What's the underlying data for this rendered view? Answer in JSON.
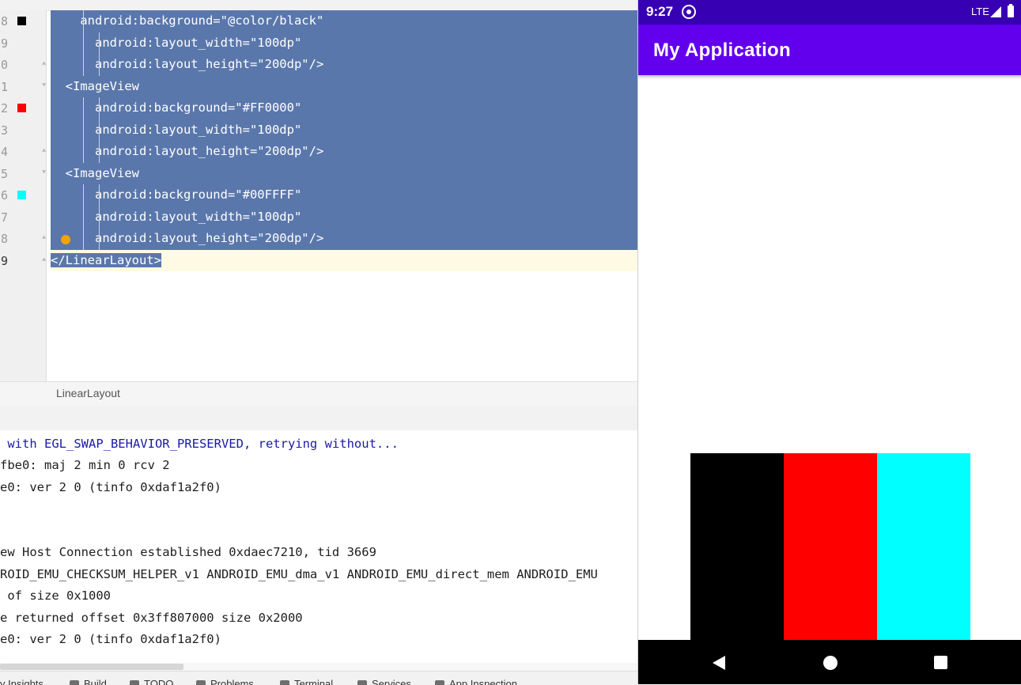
{
  "editor": {
    "lines": [
      {
        "num": "8",
        "text": "    android:background=\"@color/black\"",
        "swatch": "#000000",
        "fold": ""
      },
      {
        "num": "9",
        "text": "      android:layout_width=\"100dp\"",
        "swatch": "",
        "fold": ""
      },
      {
        "num": "0",
        "text": "      android:layout_height=\"200dp\"/>",
        "swatch": "",
        "fold": "end"
      },
      {
        "num": "1",
        "text": "  <ImageView",
        "swatch": "",
        "fold": "start"
      },
      {
        "num": "2",
        "text": "      android:background=\"#FF0000\"",
        "swatch": "#ff0000",
        "fold": ""
      },
      {
        "num": "3",
        "text": "      android:layout_width=\"100dp\"",
        "swatch": "",
        "fold": ""
      },
      {
        "num": "4",
        "text": "      android:layout_height=\"200dp\"/>",
        "swatch": "",
        "fold": "end"
      },
      {
        "num": "5",
        "text": "  <ImageView",
        "swatch": "",
        "fold": "start"
      },
      {
        "num": "6",
        "text": "      android:background=\"#00FFFF\"",
        "swatch": "#00ffff",
        "fold": ""
      },
      {
        "num": "7",
        "text": "      android:layout_width=\"100dp\"",
        "swatch": "",
        "fold": ""
      },
      {
        "num": "8",
        "text": "      android:layout_height=\"200dp\"/>",
        "swatch": "",
        "fold": "end"
      },
      {
        "num": "9",
        "text": "</LinearLayout>",
        "swatch": "",
        "fold": "end"
      }
    ],
    "selection_color": "#5a77ab",
    "intention_icon": "lightbulb-icon"
  },
  "breadcrumb": {
    "label": "LinearLayout"
  },
  "log": {
    "lines": [
      {
        "text": " with EGL_SWAP_BEHAVIOR_PRESERVED, retrying without...",
        "style": "blue"
      },
      {
        "text": "fbe0: maj 2 min 0 rcv 2",
        "style": "normal"
      },
      {
        "text": "e0: ver 2 0 (tinfo 0xdaf1a2f0)",
        "style": "normal"
      },
      {
        "text": "",
        "style": "normal"
      },
      {
        "text": "ew Host Connection established 0xdaec7210, tid 3669",
        "style": "normal"
      },
      {
        "text": "ROID_EMU_CHECKSUM_HELPER_v1 ANDROID_EMU_dma_v1 ANDROID_EMU_direct_mem ANDROID_EMU",
        "style": "normal"
      },
      {
        "text": " of size 0x1000",
        "style": "normal"
      },
      {
        "text": "e returned offset 0x3ff807000 size 0x2000",
        "style": "normal"
      },
      {
        "text": "e0: ver 2 0 (tinfo 0xdaf1a2f0)",
        "style": "normal"
      }
    ]
  },
  "toolbar": {
    "items": [
      "y Insights",
      "Build",
      "TODO",
      "Problems",
      "Terminal",
      "Services",
      "App Inspection"
    ]
  },
  "phone": {
    "status": {
      "time": "9:27",
      "network": "LTE"
    },
    "app_title": "My Application",
    "colors": {
      "status_bar": "#3700b3",
      "app_bar": "#6200ee"
    },
    "blocks": [
      {
        "name": "black",
        "color": "#000000"
      },
      {
        "name": "red",
        "color": "#ff0000"
      },
      {
        "name": "cyan",
        "color": "#00ffff"
      }
    ]
  }
}
